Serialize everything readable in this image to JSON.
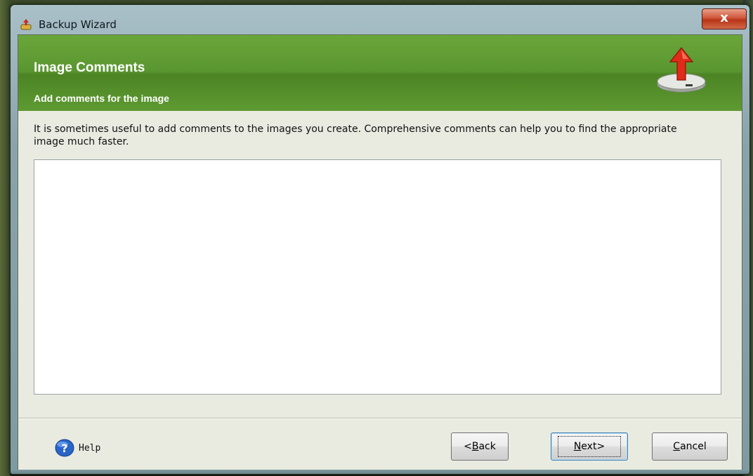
{
  "window": {
    "title": "Backup Wizard",
    "close_label": "x"
  },
  "header": {
    "title": "Image Comments",
    "subtitle": "Add comments for the image",
    "icon": "upload-disk-icon"
  },
  "body": {
    "description": "It is sometimes useful to add comments to the images you create. Comprehensive comments can help you to find the appropriate image much faster.",
    "comments_value": ""
  },
  "footer": {
    "help_label": "Help",
    "help_icon": "help-question-icon",
    "back_prefix": "<",
    "back_mnemonic": "B",
    "back_rest": "ack",
    "next_mnemonic": "N",
    "next_rest": "ext>",
    "cancel_mnemonic": "C",
    "cancel_rest": "ancel"
  },
  "colors": {
    "header_green": "#5a9630",
    "client_bg": "#e9ebe1",
    "close_red": "#c84a2c"
  }
}
